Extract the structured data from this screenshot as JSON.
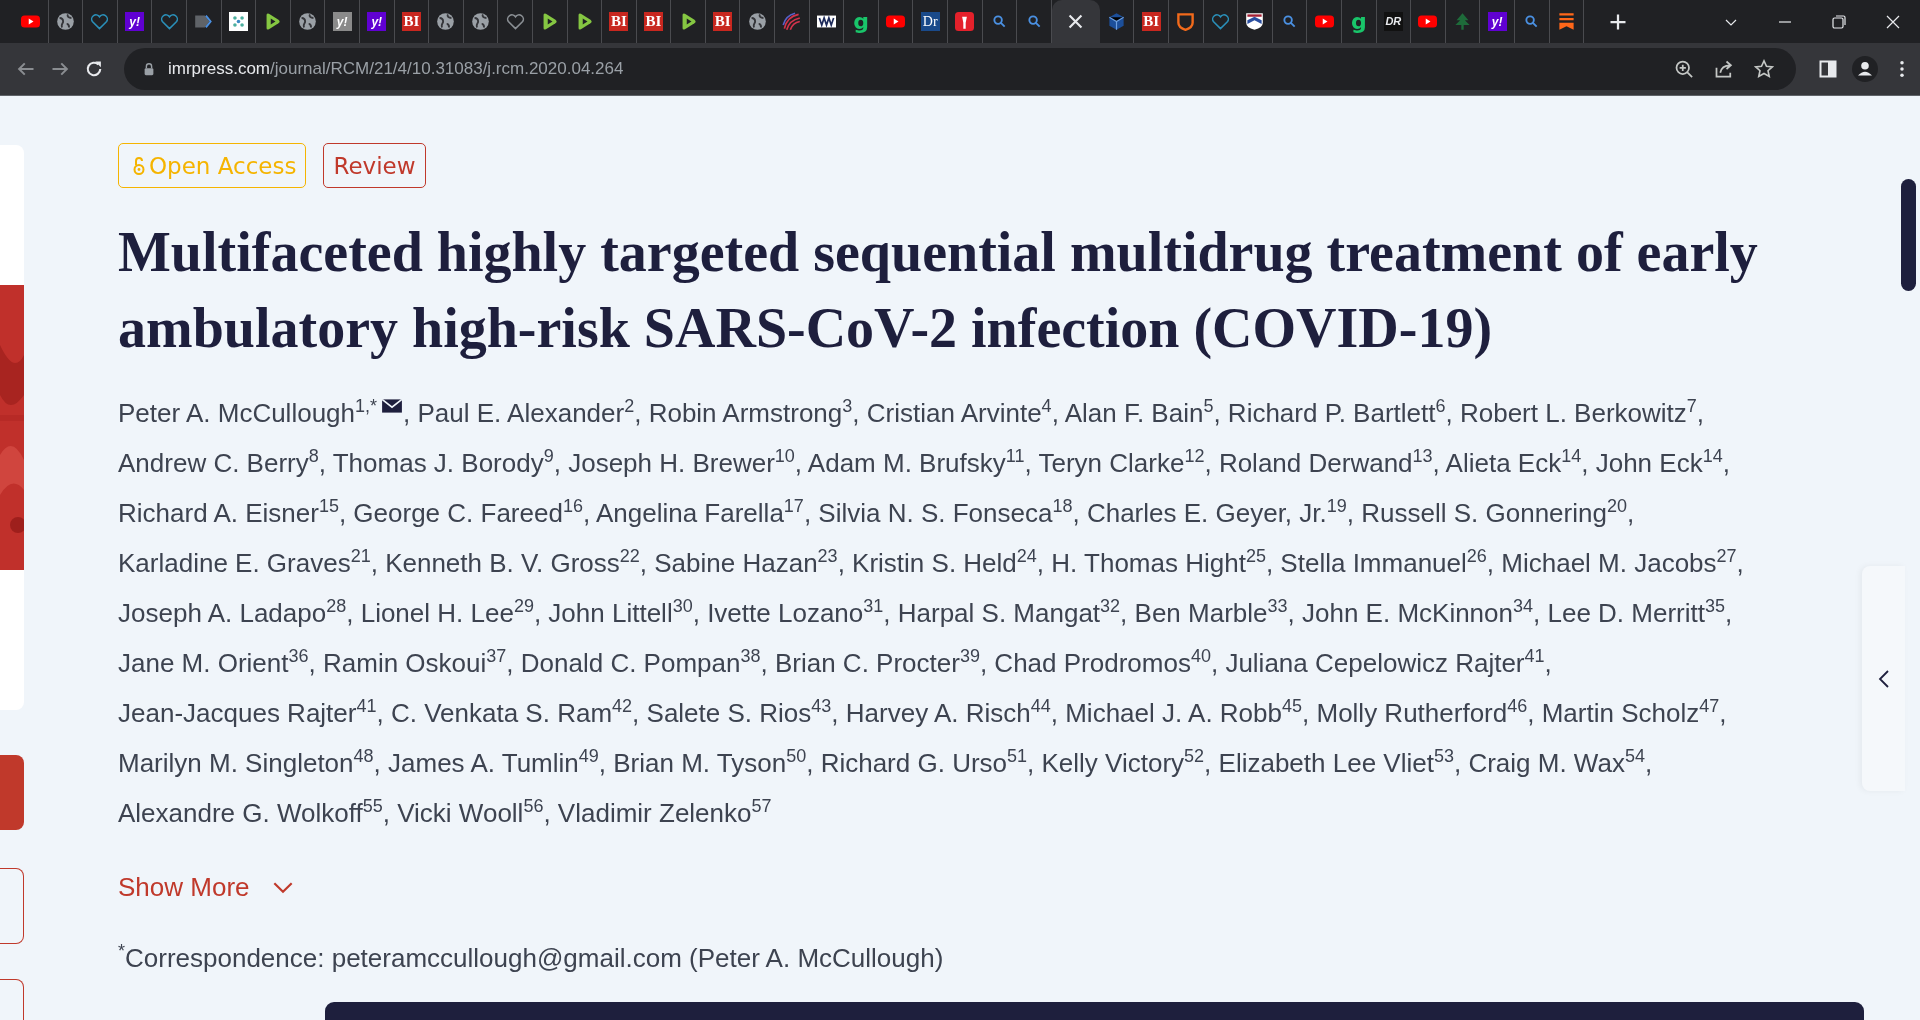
{
  "browser": {
    "tabs": [
      {
        "kind": "youtube",
        "selected": false
      },
      {
        "kind": "globe",
        "selected": false
      },
      {
        "kind": "heart",
        "selected": false
      },
      {
        "kind": "yahoo",
        "label": "y!",
        "selected": false
      },
      {
        "kind": "heart",
        "selected": false
      },
      {
        "kind": "arrow",
        "selected": false
      },
      {
        "kind": "grid",
        "selected": false
      },
      {
        "kind": "play",
        "selected": false
      },
      {
        "kind": "globe",
        "selected": false
      },
      {
        "kind": "yahoo-gray",
        "label": "y!",
        "selected": false
      },
      {
        "kind": "yahoo",
        "label": "y!",
        "selected": false
      },
      {
        "kind": "letters",
        "label": "BI",
        "selected": false
      },
      {
        "kind": "globe",
        "selected": false
      },
      {
        "kind": "globe",
        "selected": false
      },
      {
        "kind": "heart-gray",
        "selected": false
      },
      {
        "kind": "play",
        "selected": false
      },
      {
        "kind": "play",
        "selected": false
      },
      {
        "kind": "letters",
        "label": "BI",
        "selected": false
      },
      {
        "kind": "letters",
        "label": "BI",
        "selected": false
      },
      {
        "kind": "play",
        "selected": false
      },
      {
        "kind": "letters",
        "label": "BI",
        "selected": false
      },
      {
        "kind": "globe",
        "selected": false
      },
      {
        "kind": "swirl",
        "selected": false
      },
      {
        "kind": "stripes",
        "selected": false
      },
      {
        "kind": "green-letter",
        "label": "g",
        "selected": false
      },
      {
        "kind": "youtube",
        "selected": false
      },
      {
        "kind": "dark-letters",
        "label": "Dr",
        "selected": false
      },
      {
        "kind": "torch",
        "selected": false
      },
      {
        "kind": "search",
        "selected": false
      },
      {
        "kind": "search",
        "selected": false
      },
      {
        "kind": "close",
        "selected": true
      },
      {
        "kind": "cube",
        "selected": false
      },
      {
        "kind": "letters",
        "label": "BI",
        "selected": false
      },
      {
        "kind": "shield",
        "selected": false
      },
      {
        "kind": "heart",
        "selected": false
      },
      {
        "kind": "crest",
        "selected": false
      },
      {
        "kind": "search",
        "selected": false
      },
      {
        "kind": "youtube",
        "selected": false
      },
      {
        "kind": "green-letter",
        "label": "g",
        "selected": false
      },
      {
        "kind": "italic-letters",
        "label": "DR",
        "selected": false
      },
      {
        "kind": "youtube",
        "selected": false
      },
      {
        "kind": "tree",
        "selected": false
      },
      {
        "kind": "yahoo",
        "label": "y!",
        "selected": false
      },
      {
        "kind": "search",
        "selected": false
      },
      {
        "kind": "bookmark",
        "selected": false
      }
    ],
    "url": {
      "domain": "imrpress.com",
      "path": "/journal/RCM/21/4/10.31083/j.rcm.2020.04.264"
    }
  },
  "article": {
    "badges": [
      {
        "kind": "open-access",
        "label": "Open Access"
      },
      {
        "kind": "type",
        "label": "Review"
      }
    ],
    "title": "Multifaceted highly targeted sequential multidrug treatment of early ambulatory high-risk SARS-CoV-2 infection (COVID-19)",
    "author_lines": [
      [
        {
          "kind": "text",
          "text": "Peter A. McCullough$^{1,*}$"
        },
        {
          "kind": "mail"
        },
        {
          "kind": "text",
          "text": ", Paul E. Alexander$^{2}$, Robin Armstrong$^{3}$, Cristian Arvinte$^{4}$, Alan F. Bain$^{5}$, Richard P. Bartlett$^{6}$, Robert L. Berkowitz$^{7}$,"
        }
      ],
      [
        {
          "kind": "text",
          "text": "Andrew C. Berry$^{8}$, Thomas J. Borody$^{9}$, Joseph H. Brewer$^{10}$, Adam M. Brufsky$^{11}$, Teryn Clarke$^{12}$, Roland Derwand$^{13}$, Alieta Eck$^{14}$, John Eck$^{14}$,"
        }
      ],
      [
        {
          "kind": "text",
          "text": "Richard A. Eisner$^{15}$, George C. Fareed$^{16}$, Angelina Farella$^{17}$, Silvia N. S. Fonseca$^{18}$, Charles E. Geyer, Jr.$^{19}$, Russell S. Gonnering$^{20}$,"
        }
      ],
      [
        {
          "kind": "text",
          "text": "Karladine E. Graves$^{21}$, Kenneth B. V. Gross$^{22}$, Sabine Hazan$^{23}$, Kristin S. Held$^{24}$, H. Thomas Hight$^{25}$, Stella Immanuel$^{26}$, Michael M. Jacobs$^{27}$,"
        }
      ],
      [
        {
          "kind": "text",
          "text": "Joseph A. Ladapo$^{28}$, Lionel H. Lee$^{29}$, John Littell$^{30}$, Ivette Lozano$^{31}$, Harpal S. Mangat$^{32}$, Ben Marble$^{33}$, John E. McKinnon$^{34}$, Lee D. Merritt$^{35}$,"
        }
      ],
      [
        {
          "kind": "text",
          "text": "Jane M. Orient$^{36}$, Ramin Oskoui$^{37}$, Donald C. Pompan$^{38}$, Brian C. Procter$^{39}$, Chad Prodromos$^{40}$, Juliana Cepelowicz Rajter$^{41}$,"
        }
      ],
      [
        {
          "kind": "text",
          "text": "Jean-Jacques Rajter$^{41}$, C. Venkata S. Ram$^{42}$, Salete S. Rios$^{43}$, Harvey A. Risch$^{44}$, Michael J. A. Robb$^{45}$, Molly Rutherford$^{46}$, Martin Scholz$^{47}$,"
        }
      ],
      [
        {
          "kind": "text",
          "text": "Marilyn M. Singleton$^{48}$, James A. Tumlin$^{49}$, Brian M. Tyson$^{50}$, Richard G. Urso$^{51}$, Kelly Victory$^{52}$, Elizabeth Lee Vliet$^{53}$, Craig M. Wax$^{54}$,"
        }
      ],
      [
        {
          "kind": "text",
          "text": "Alexandre G. Wolkoff$^{55}$, Vicki Wooll$^{56}$, Vladimir Zelenko$^{57}$"
        }
      ]
    ],
    "show_more": "Show More",
    "correspondence": "$^{*}$Correspondence: peteramccullough@gmail.com (Peter A. McCullough)"
  }
}
